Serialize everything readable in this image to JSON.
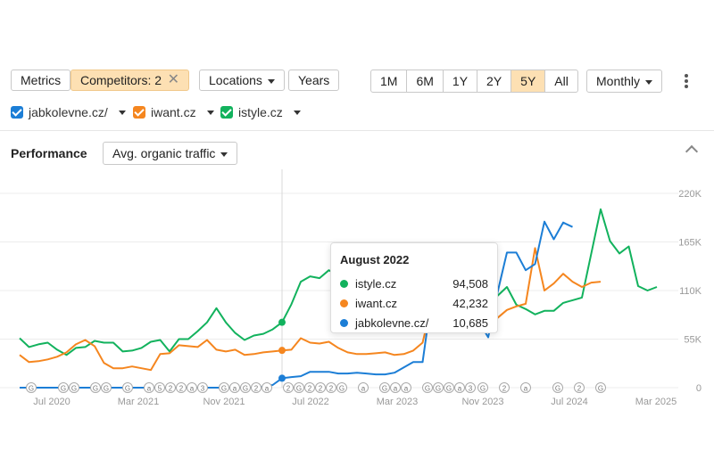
{
  "toolbar": {
    "metrics_label": "Metrics",
    "competitors_label": "Competitors: 2",
    "locations_label": "Locations",
    "years_label": "Years",
    "ranges": [
      "1M",
      "6M",
      "1Y",
      "2Y",
      "5Y",
      "All"
    ],
    "selected_range": "5Y",
    "interval_label": "Monthly"
  },
  "legend": [
    {
      "name": "jabkolevne.cz/",
      "color": "#1c7ed6"
    },
    {
      "name": "iwant.cz",
      "color": "#f5861f"
    },
    {
      "name": "istyle.cz",
      "color": "#12b25d"
    }
  ],
  "performance": {
    "title": "Performance",
    "metric_label": "Avg. organic traffic"
  },
  "tooltip": {
    "title": "August 2022",
    "rows": [
      {
        "name": "istyle.cz",
        "value": "94,508",
        "color": "#12b25d"
      },
      {
        "name": "iwant.cz",
        "value": "42,232",
        "color": "#f5861f"
      },
      {
        "name": "jabkolevne.cz/",
        "value": "10,685",
        "color": "#1c7ed6"
      }
    ]
  },
  "chart_data": {
    "type": "line",
    "x_tick_labels": [
      "Jul 2020",
      "Mar 2021",
      "Nov 2021",
      "Jul 2022",
      "Mar 2023",
      "Nov 2023",
      "Jul 2024",
      "Mar 2025"
    ],
    "y_tick_labels": [
      "220K",
      "165K",
      "110K",
      "55K",
      "0"
    ],
    "ylim": [
      0,
      220000
    ],
    "series": [
      {
        "name": "istyle.cz",
        "color": "#12b25d",
        "values": [
          56000,
          46000,
          49000,
          51000,
          43000,
          37000,
          45000,
          46000,
          53000,
          51000,
          51000,
          41000,
          42000,
          45000,
          52000,
          54000,
          41000,
          55000,
          55000,
          64000,
          74000,
          90000,
          74000,
          62000,
          54000,
          59000,
          61000,
          66000,
          74000,
          94508,
          120000,
          126000,
          124000,
          133000,
          127000,
          121000,
          113000,
          117000,
          118000,
          112000,
          119000,
          122000,
          124000,
          116000,
          117000,
          124000,
          118000,
          124000,
          124000,
          117000,
          112000,
          104000,
          114000,
          94000,
          89000,
          83000,
          87000,
          87000,
          96000,
          99000,
          102000,
          152000,
          202000,
          166000,
          152000,
          160000,
          115000,
          110000,
          114000
        ]
      },
      {
        "name": "iwant.cz",
        "color": "#f5861f",
        "values": [
          37000,
          29000,
          30000,
          32000,
          35000,
          40000,
          49000,
          54000,
          47000,
          28000,
          22000,
          22000,
          24000,
          22000,
          20000,
          38000,
          39000,
          48000,
          47000,
          46000,
          54000,
          43000,
          41000,
          43000,
          37000,
          38000,
          40000,
          41000,
          42232,
          43000,
          56000,
          51000,
          50000,
          52000,
          45000,
          40000,
          38000,
          38000,
          39000,
          40000,
          37000,
          38000,
          42000,
          51000,
          96000,
          104000,
          95000,
          85000,
          82000,
          70000,
          70000,
          79000,
          88000,
          92000,
          95000,
          158000,
          110000,
          118000,
          129000,
          120000,
          114000,
          119000,
          120000
        ]
      },
      {
        "name": "jabkolevne.cz/",
        "color": "#1c7ed6",
        "values": [
          0,
          0,
          0,
          0,
          0,
          0,
          0,
          0,
          0,
          0,
          0,
          0,
          0,
          0,
          0,
          0,
          0,
          0,
          0,
          0,
          0,
          0,
          0,
          0,
          0,
          0,
          1000,
          3000,
          10685,
          12000,
          13000,
          18000,
          18000,
          18000,
          16000,
          16000,
          17000,
          16000,
          15000,
          15000,
          17000,
          23000,
          29000,
          29000,
          105000,
          98000,
          104000,
          104000,
          95000,
          75000,
          57000,
          108000,
          153000,
          153000,
          133000,
          140000,
          188000,
          168000,
          187000,
          182000
        ]
      }
    ],
    "series_x_offset": [
      0,
      0,
      0
    ],
    "marker_label": "G",
    "annotations": [
      "G",
      "G",
      "G",
      "G",
      "G",
      "G",
      "a",
      "5",
      "2",
      "2",
      "a",
      "3",
      "G",
      "a",
      "G",
      "2",
      "a",
      "2",
      "G",
      "2",
      "2",
      "2",
      "G",
      "a",
      "G",
      "a",
      "a",
      "G",
      "G",
      "G",
      "a",
      "3",
      "G",
      "2",
      "a",
      "G",
      "2",
      "G"
    ],
    "grid": true,
    "highlight_index": 28
  }
}
